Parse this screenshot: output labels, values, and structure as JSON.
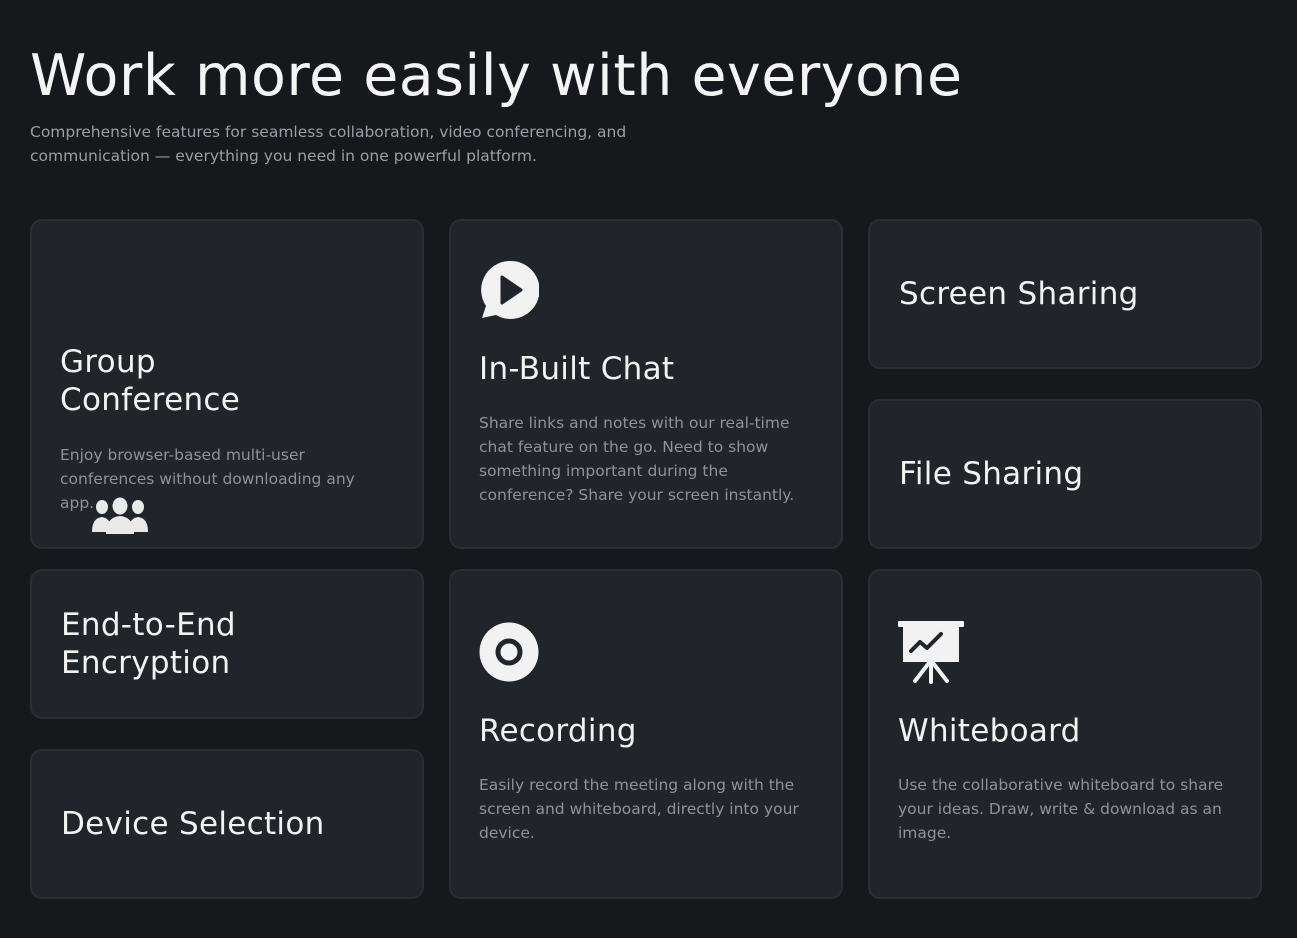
{
  "header": {
    "title": "Work more easily with everyone",
    "subtitle": "Comprehensive features for seamless collaboration, video conferencing, and communication — everything you need in one powerful platform."
  },
  "features": {
    "group_conference": {
      "title": "Group Conference",
      "description": "Enjoy browser-based multi-user conferences without downloading any app.",
      "icon": "users-group-icon"
    },
    "in_built_chat": {
      "title": "In-Built Chat",
      "description": "Share links and notes with our real-time chat feature on the go. Need to show something important during the conference? Share your screen instantly.",
      "icon": "chat-play-icon"
    },
    "screen_sharing": {
      "title": "Screen Sharing"
    },
    "file_sharing": {
      "title": "File Sharing"
    },
    "e2e_encryption": {
      "title": "End-to-End Encryption"
    },
    "device_selection": {
      "title": "Device Selection"
    },
    "recording": {
      "title": "Recording",
      "description": "Easily record the meeting along with the screen and whiteboard, directly into your device.",
      "icon": "record-icon"
    },
    "whiteboard": {
      "title": "Whiteboard",
      "description": "Use the collaborative whiteboard to share your ideas. Draw, write & download as an image.",
      "icon": "whiteboard-icon"
    }
  },
  "colors": {
    "background": "#17181c",
    "card": "#212429",
    "card_border": "#2a2e34",
    "title_text": "#f4f4f5",
    "body_text": "#8e929a"
  }
}
